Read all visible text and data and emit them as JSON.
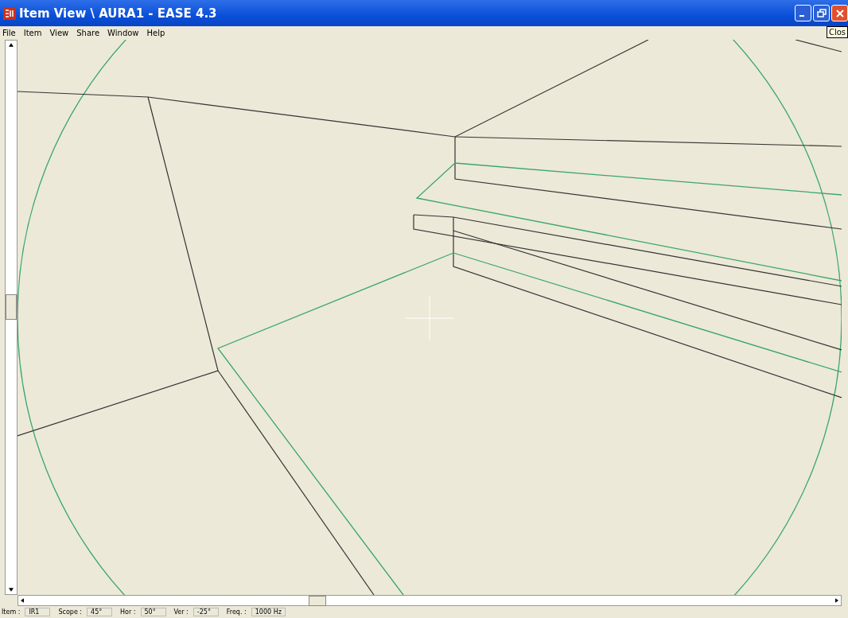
{
  "window": {
    "title": "Item View \\ AURA1 - EASE 4.3"
  },
  "menu": [
    "File",
    "Item",
    "View",
    "Share",
    "Window",
    "Help"
  ],
  "tooltip": "Clos",
  "status_bar": [
    {
      "label": "Item :",
      "value": "IR1"
    },
    {
      "label": "Scope :",
      "value": "45°"
    },
    {
      "label": "Hor :",
      "value": "50°"
    },
    {
      "label": "Ver :",
      "value": "-25°"
    },
    {
      "label": "Freq. :",
      "value": "1000 Hz"
    }
  ]
}
